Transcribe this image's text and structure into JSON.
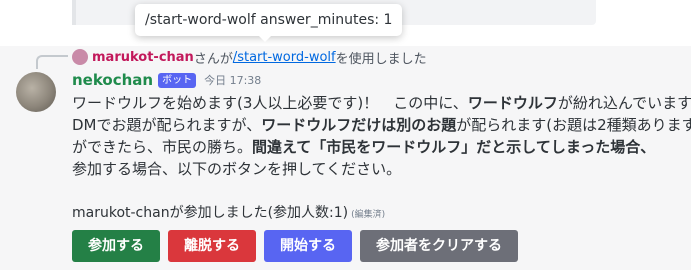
{
  "tooltip": {
    "text": "/start-word-wolf answer_minutes: 1"
  },
  "reply": {
    "user": "marukot-chan",
    "mid": "さんが",
    "command": "/start-word-wolf",
    "suffix": "を使用しました"
  },
  "message": {
    "author": "nekochan",
    "bot_tag": "ボット",
    "timestamp": "今日 17:38",
    "lines": [
      [
        "ワードウルフを始めます(3人以上必要です)！　この中に、",
        "ワードウルフ",
        "が紛れ込んでいます"
      ],
      [
        "DMでお題が配られますが、",
        "ワードウルフだけは別のお題",
        "が配られます(お題は2種類あります"
      ],
      [
        "ができたら、市民の勝ち。",
        "間違えて「市民をワードウルフ」だと示してしまった場合、",
        ""
      ],
      [
        "参加する場合、以下のボタンを押してください。",
        "",
        ""
      ]
    ],
    "status": "marukot-chanが参加しました(参加人数:1)",
    "edited": "(編集済)"
  },
  "buttons": {
    "join": "参加する",
    "leave": "離脱する",
    "start": "開始する",
    "clear": "参加者をクリアする"
  }
}
